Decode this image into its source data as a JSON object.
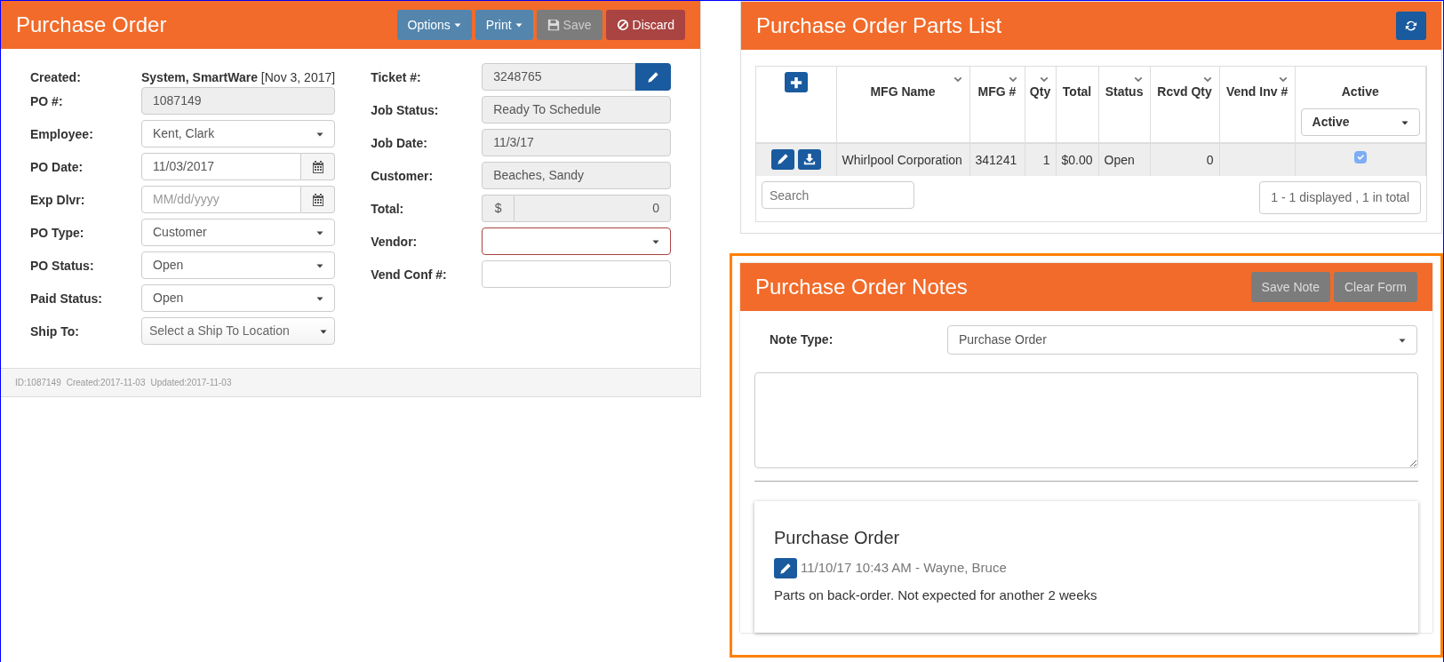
{
  "purchase_order": {
    "title": "Purchase Order",
    "buttons": [
      {
        "label": "Options",
        "kind": "dropdown",
        "disabled": false
      },
      {
        "label": "Print",
        "kind": "dropdown",
        "disabled": false
      },
      {
        "label": "Save",
        "kind": "save",
        "disabled": true
      },
      {
        "label": "Discard",
        "kind": "discard",
        "disabled": false
      }
    ],
    "left_fields": [
      {
        "label": "Created:",
        "kind": "static",
        "value": "**System, SmartWare** [Nov 3, 2017]"
      },
      {
        "label": "PO #:",
        "kind": "readonly",
        "value": "1087149"
      },
      {
        "label": "Employee:",
        "kind": "select",
        "value": "Kent, Clark"
      },
      {
        "label": "PO Date:",
        "kind": "date",
        "value": "11/03/2017"
      },
      {
        "label": "Exp Dlvr:",
        "kind": "date",
        "placeholder": "MM/dd/yyyy"
      },
      {
        "label": "PO Type:",
        "kind": "select",
        "value": "Customer"
      },
      {
        "label": "PO Status:",
        "kind": "select",
        "value": "Open"
      },
      {
        "label": "Paid Status:",
        "kind": "select",
        "value": "Open"
      },
      {
        "label": "Ship To:",
        "kind": "chosen",
        "placeholder": "Select a Ship To Location"
      }
    ],
    "right_fields": [
      {
        "label": "Ticket #:",
        "kind": "readonly-edit",
        "value": "3248765"
      },
      {
        "label": "Job Status:",
        "kind": "readonly",
        "value": "Ready To Schedule"
      },
      {
        "label": "Job Date:",
        "kind": "readonly",
        "value": "11/3/17"
      },
      {
        "label": "Customer:",
        "kind": "readonly",
        "value": "Beaches, Sandy"
      },
      {
        "label": "Total:",
        "kind": "currency",
        "addon": "$",
        "value": "0"
      },
      {
        "label": "Vendor:",
        "kind": "select",
        "invalid": true
      },
      {
        "label": "Vend Conf #:",
        "kind": "input"
      }
    ],
    "footer": [
      "ID:1087149",
      "Created:2017-11-03",
      "Updated:2017-11-03"
    ]
  },
  "parts_list": {
    "title": "Purchase Order Parts List",
    "columns": [
      {
        "label": "MFG Name",
        "sortable": true
      },
      {
        "label": "MFG #",
        "sortable": true
      },
      {
        "label": "Qty",
        "sortable": true
      },
      {
        "label": "Total",
        "sortable": false
      },
      {
        "label": "Status",
        "sortable": true
      },
      {
        "label": "Rcvd Qty",
        "sortable": true
      },
      {
        "label": "Vend Inv #",
        "sortable": true
      },
      {
        "label": "Active",
        "sortable": false
      }
    ],
    "active_filter": "Active",
    "rows": [
      {
        "cells": [
          "Whirlpool Corporation",
          "341241",
          "1",
          "$0.00",
          "Open",
          "0",
          ""
        ],
        "active": true
      }
    ],
    "search": {
      "placeholder": "Search"
    },
    "pager": "1 - 1 displayed , 1 in total"
  },
  "notes": {
    "title": "Purchase Order Notes",
    "buttons": [
      {
        "label": "Save Note",
        "disabled": true
      },
      {
        "label": "Clear Form",
        "disabled": true
      }
    ],
    "note_type": {
      "label": "Note Type:",
      "value": "Purchase Order"
    },
    "entries": [
      {
        "title": "Purchase Order",
        "meta": "11/10/17 10:43 AM - Wayne, Bruce",
        "body": "Parts on back-order. Not expected for another 2 weeks"
      }
    ]
  }
}
